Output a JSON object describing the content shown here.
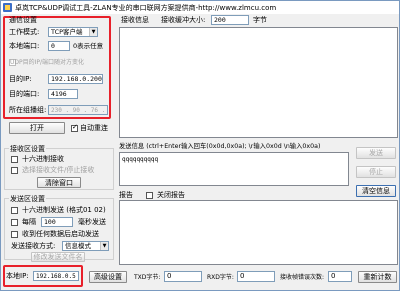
{
  "window": {
    "title": "卓岚TCP&UDP调试工具-ZLAN专业的串口联网方案提供商-http://www.zlmcu.com"
  },
  "network_settings": {
    "group_title": "通信设置",
    "work_mode_label": "工作模式:",
    "work_mode_value": "TCP客户端",
    "local_port_label": "本地端口:",
    "local_port_value": "0",
    "local_port_hint": "0表示任意",
    "udp_follow_label": "UDP目的IP/端口随对方变化",
    "dest_ip_label": "目的IP:",
    "dest_ip_value": "192.168.0.200",
    "dest_port_label": "目的端口:",
    "dest_port_value": "4196",
    "multicast_label": "所在组播组:",
    "multicast_value": "230 . 90 . 76 . 1",
    "open_button": "打开",
    "auto_reconnect_label": "自动重连"
  },
  "receive_settings": {
    "group_title": "接收区设置",
    "hex_receive_label": "十六进制接收",
    "select_file_label": "选择接收文件/停止接收",
    "clear_window_button": "清除窗口"
  },
  "send_settings": {
    "group_title": "发送区设置",
    "hex_send_label": "十六进制发送 (格式01 02)",
    "interval_label": "每隔",
    "interval_value": "100",
    "interval_unit": "毫秒发送",
    "receive_data_send_label": "收到任何数据后启动发送",
    "send_method_label": "发送接收方式:",
    "send_method_value": "信息模式",
    "modify_file_button": "修改发送文件名"
  },
  "receive_area": {
    "info_label": "接收信息",
    "buffer_label": "接收缓冲大小:",
    "buffer_value": "200",
    "buffer_unit": "字节"
  },
  "send_area": {
    "info_label": "发送信息 (ctrl+Enter输入回车(0x0d,0x0a); \\r输入0x0d \\n输入0x0a)",
    "content": "qqqqqqqqqq",
    "send_button": "发送",
    "stop_button": "停止",
    "clear_button": "清空信息"
  },
  "report_area": {
    "label": "报告",
    "close_report_label": "关闭报告"
  },
  "status_bar": {
    "local_ip_label": "本地IP:",
    "local_ip_value": "192.168.0.5",
    "advanced_button": "高级设置",
    "tx_label": "TXD字节:",
    "tx_value": "0",
    "rx_label": "RXD字节:",
    "rx_value": "0",
    "wrong_frame_label": "接收帧错误次数:",
    "wrong_frame_value": "0",
    "recount_button": "重新计数"
  },
  "highlight_color": "#e8202a"
}
